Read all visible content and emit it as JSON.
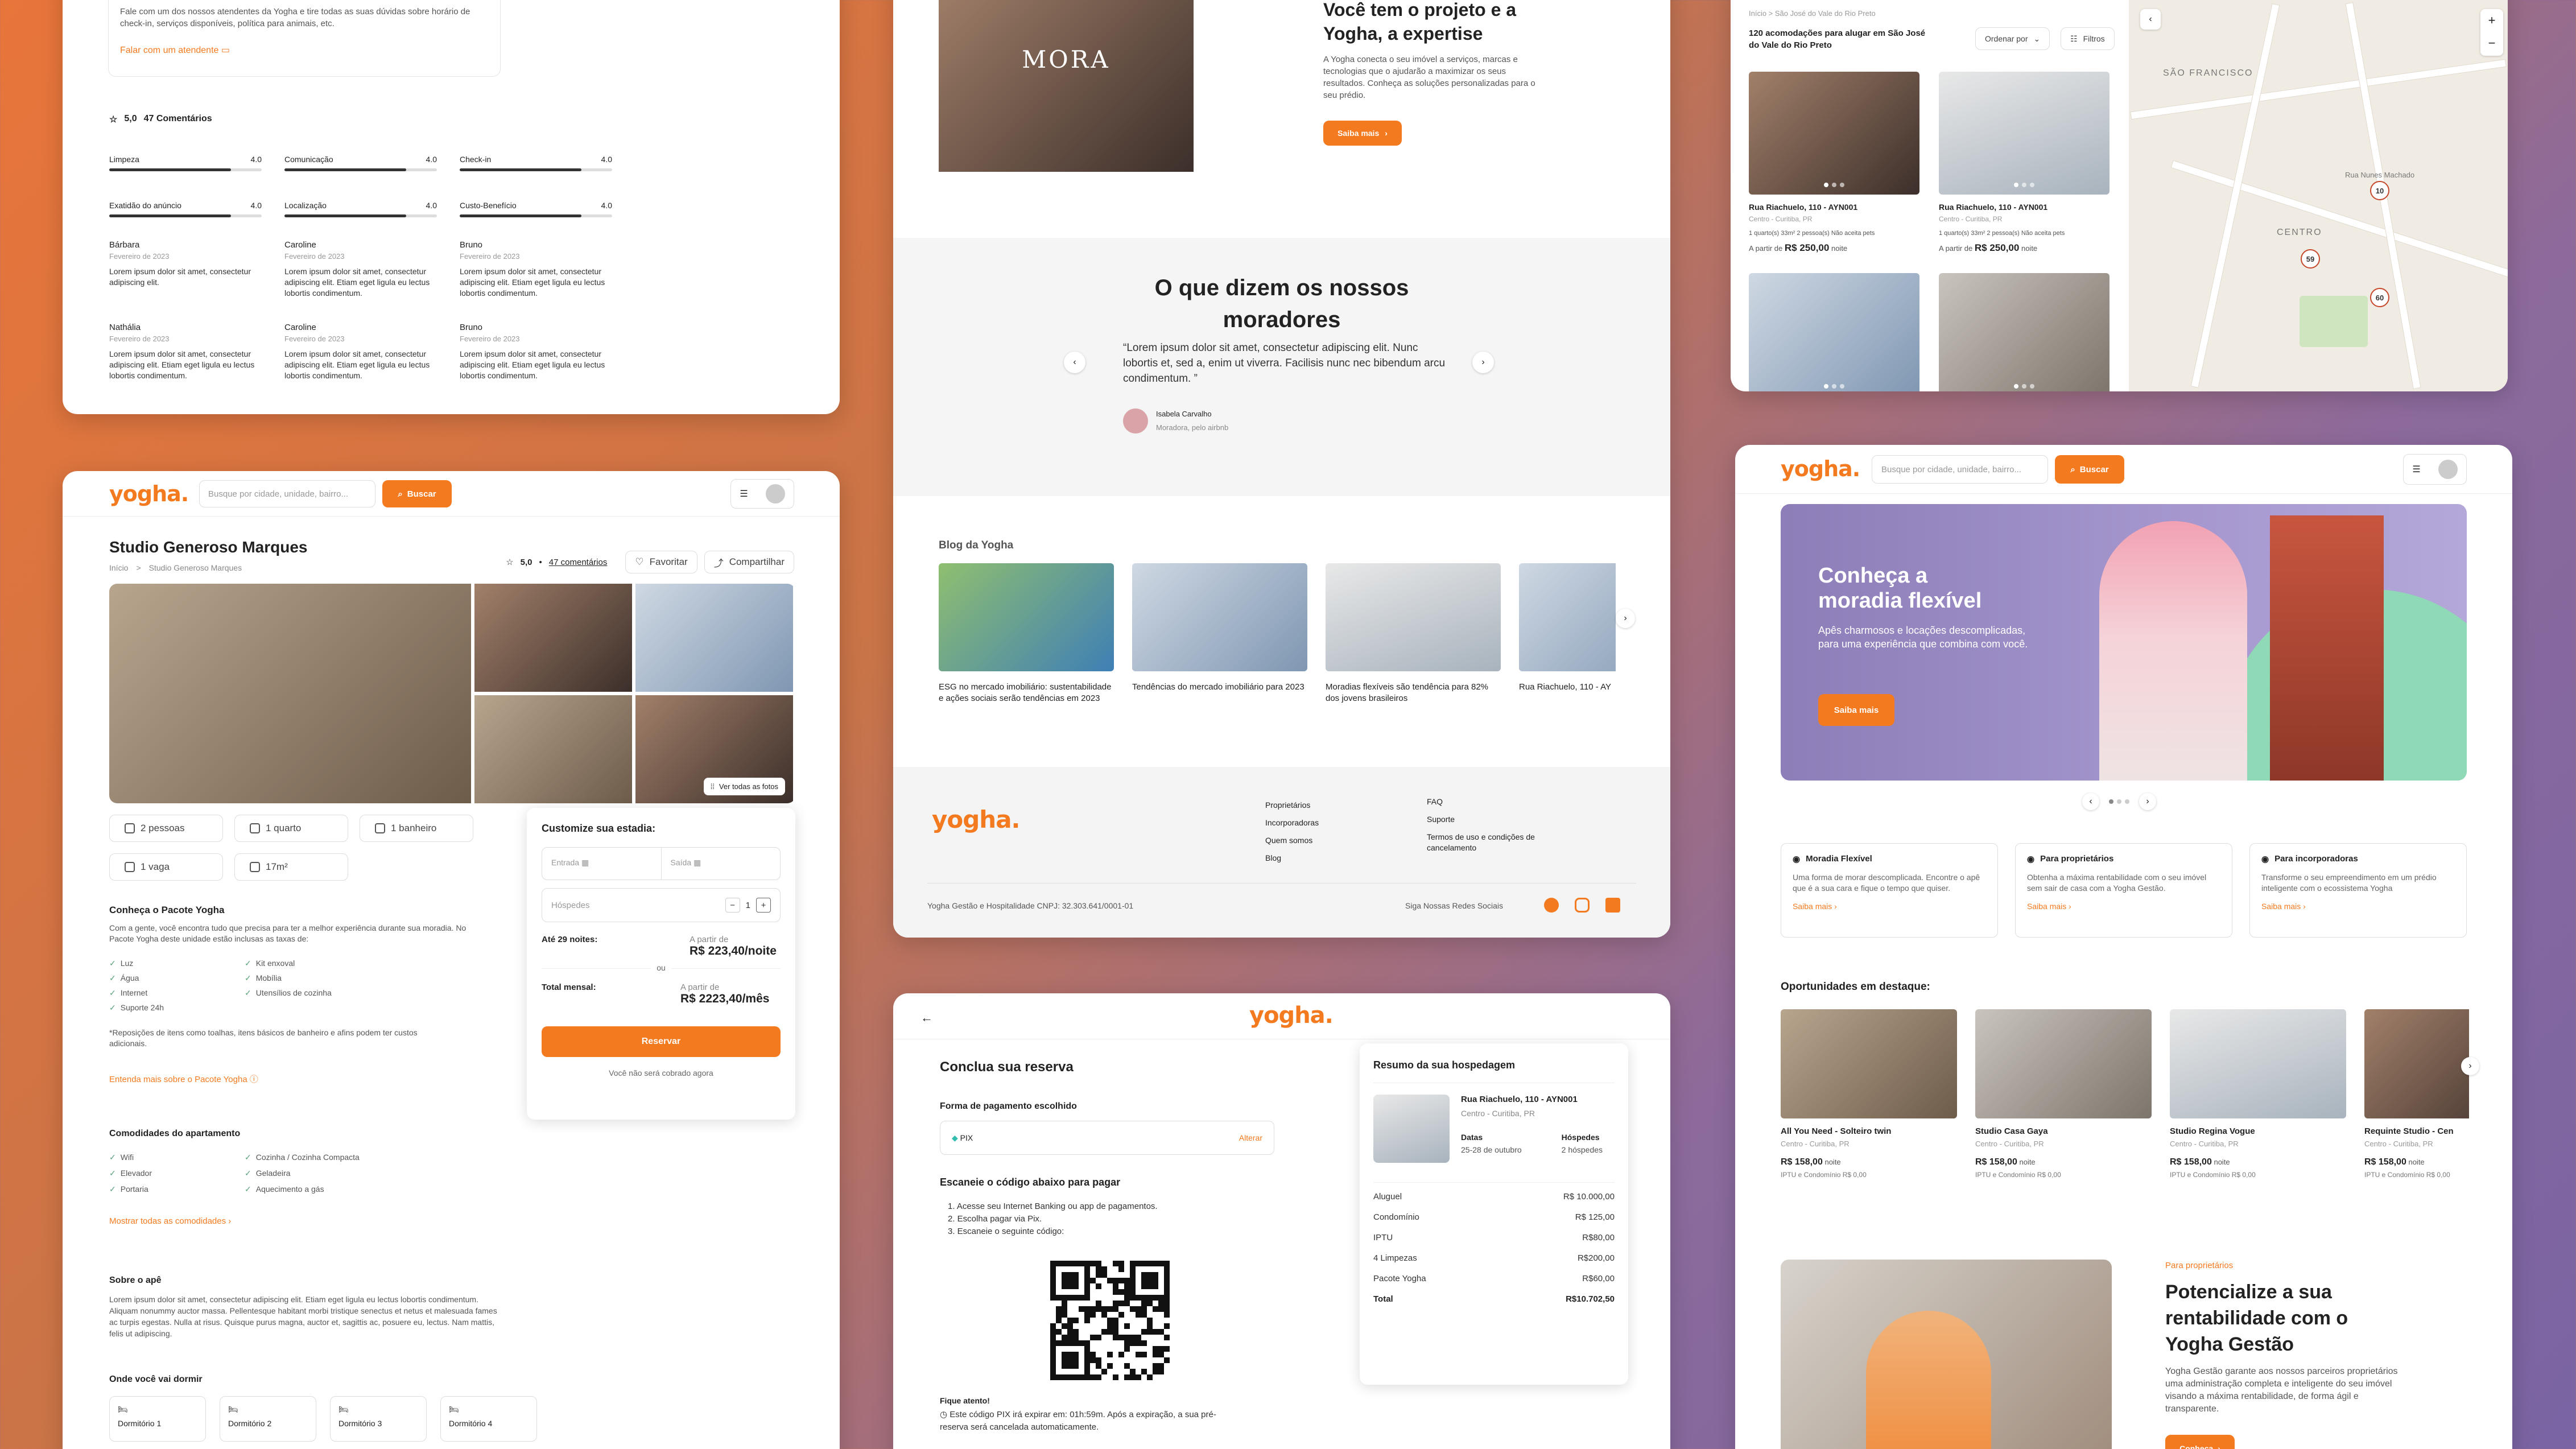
{
  "brand": {
    "logo": "yogha.",
    "accent": "#f47a20"
  },
  "reviews_card": {
    "intro": "Fale com um dos nossos atendentes da Yogha e tire todas as suas dúvidas sobre horário de check-in, serviços disponíveis, política para animais, etc.",
    "contact_link": "Falar com um atendente",
    "rating": "5,0",
    "comments": "47 Comentários",
    "criteria": [
      {
        "label": "Limpeza",
        "score": "4.0",
        "value": 0.8
      },
      {
        "label": "Comunicação",
        "score": "4.0",
        "value": 0.8
      },
      {
        "label": "Check-in",
        "score": "4.0",
        "value": 0.8
      },
      {
        "label": "Exatidão do anúncio",
        "score": "4.0",
        "value": 0.8
      },
      {
        "label": "Localização",
        "score": "4.0",
        "value": 0.8
      },
      {
        "label": "Custo-Benefício",
        "score": "4.0",
        "value": 0.8
      }
    ],
    "reviews": [
      {
        "name": "Bárbara",
        "date": "Fevereiro de 2023",
        "text": "Lorem ipsum dolor sit amet, consectetur adipiscing elit."
      },
      {
        "name": "Caroline",
        "date": "Fevereiro de 2023",
        "text": "Lorem ipsum dolor sit amet, consectetur adipiscing elit. Etiam eget ligula eu lectus lobortis condimentum."
      },
      {
        "name": "Bruno",
        "date": "Fevereiro de 2023",
        "text": "Lorem ipsum dolor sit amet, consectetur adipiscing elit. Etiam eget ligula eu lectus lobortis condimentum."
      },
      {
        "name": "Nathália",
        "date": "Fevereiro de 2023",
        "text": "Lorem ipsum dolor sit amet, consectetur adipiscing elit. Etiam eget ligula eu lectus lobortis condimentum."
      },
      {
        "name": "Caroline",
        "date": "Fevereiro de 2023",
        "text": "Lorem ipsum dolor sit amet, consectetur adipiscing elit. Etiam eget ligula eu lectus lobortis condimentum."
      },
      {
        "name": "Bruno",
        "date": "Fevereiro de 2023",
        "text": "Lorem ipsum dolor sit amet, consectetur adipiscing elit. Etiam eget ligula eu lectus lobortis condimentum."
      }
    ]
  },
  "listing": {
    "search_placeholder": "Busque por cidade, unidade, bairro...",
    "search_btn": "Buscar",
    "title": "Studio Generoso Marques",
    "breadcrumb": [
      "Início",
      ">",
      "Studio Generoso Marques"
    ],
    "rating": "5,0",
    "comments": "47 comentários",
    "fav": "Favoritar",
    "share": "Compartilhar",
    "see_photos": "Ver todas as fotos",
    "features": [
      "2 pessoas",
      "1 quarto",
      "1 banheiro",
      "1 vaga",
      "17m²"
    ],
    "pack_title": "Conheça o Pacote Yogha",
    "pack_text": "Com a gente, você encontra tudo que precisa para ter a melhor experiência durante sua moradia. No Pacote Yogha deste unidade estão inclusas as taxas de:",
    "pack_items_a": [
      "Luz",
      "Água",
      "Internet",
      "Suporte 24h"
    ],
    "pack_items_b": [
      "Kit enxoval",
      "Mobília",
      "Utensílios de cozinha"
    ],
    "pack_note": "*Reposições de itens como toalhas, itens básicos de banheiro e afins podem ter custos adicionais.",
    "pack_link": "Entenda mais sobre o Pacote Yogha",
    "amen_title": "Comodidades do apartamento",
    "amen_a": [
      "Wifi",
      "Elevador",
      "Portaria"
    ],
    "amen_b": [
      "Cozinha / Cozinha Compacta",
      "Geladeira",
      "Aquecimento a gás"
    ],
    "amen_link": "Mostrar todas as comodidades",
    "about_title": "Sobre o apê",
    "about_text": "Lorem ipsum dolor sit amet, consectetur adipiscing elit. Etiam eget ligula eu lectus lobortis condimentum. Aliquam nonummy auctor massa. Pellentesque habitant morbi tristique senectus et netus et malesuada fames ac turpis egestas. Nulla at risus. Quisque purus magna, auctor et, sagittis ac, posuere eu, lectus. Nam mattis, felis ut adipiscing.",
    "sleep_title": "Onde você vai dormir",
    "rooms": [
      "Dormitório 1",
      "Dormitório 2",
      "Dormitório 3",
      "Dormitório 4"
    ],
    "box": {
      "title": "Customize sua estadia:",
      "entrada": "Entrada",
      "saida": "Saída",
      "hospedes": "Hóspedes",
      "qty": "1",
      "nights_label": "Até 29 noites:",
      "from": "A partir de",
      "nightly": "R$ 223,40/noite",
      "or": "ou",
      "monthly_label": "Total mensal:",
      "monthly": "R$ 2223,40/mês",
      "reserve": "Reservar",
      "note": "Você não será cobrado agora"
    }
  },
  "home_mid": {
    "hero_title": "Você tem o projeto e a Yogha, a expertise",
    "hero_text": "A Yogha conecta o seu imóvel a serviços, marcas e tecnologias que o ajudarão a maximizar os seus resultados. Conheça as soluções personalizadas para o seu prédio.",
    "hero_btn": "Saiba mais",
    "building_sign": "MORA",
    "testi_title": "O que dizem os nossos moradores",
    "testi_quote": "“Lorem ipsum dolor sit amet, consectetur adipiscing elit. Nunc lobortis et, sed a, enim ut viverra. Facilisis nunc nec bibendum arcu condimentum. ”",
    "testi_name": "Isabela Carvalho",
    "testi_role": "Moradora, pelo airbnb",
    "blog_title": "Blog da Yogha",
    "posts": [
      "ESG no mercado imobiliário: sustentabilidade e ações sociais serão tendências em 2023",
      "Tendências do mercado imobiliário para 2023",
      "Moradias flexíveis são tendência para 82% dos jovens brasileiros",
      "Rua Riachuelo, 110 - AY"
    ],
    "footer_col1": [
      "Proprietários",
      "Incorporadoras",
      "Quem somos",
      "Blog"
    ],
    "footer_col2": [
      "FAQ",
      "Suporte",
      "Termos de uso e condições de cancelamento"
    ],
    "footer_legal": "Yogha Gestão e Hospitalidade CNPJ: 32.303.641/0001-01",
    "footer_social": "Siga Nossas Redes Sociais"
  },
  "checkout": {
    "title": "Conclua sua reserva",
    "pay_label": "Forma de pagamento escolhido",
    "pay_method": "PIX",
    "pay_change": "Alterar",
    "scan_title": "Escaneie o código abaixo para pagar",
    "steps": [
      "1. Acesse seu Internet Banking ou app de pagamentos.",
      "2. Escolha pagar via Pix.",
      "3. Escaneie o seguinte código:"
    ],
    "warn_title": "Fique atento!",
    "warn_text": "Este código PIX irá expirar em: 01h:59m. Após a expiração, a sua pré-reserva será cancelada automaticamente.",
    "summary_title": "Resumo da sua hospedagem",
    "unit": "Rua Riachuelo, 110 - AYN001",
    "unit_loc": "Centro - Curitiba, PR",
    "dates_label": "Datas",
    "dates": "25-28 de outubro",
    "guests_label": "Hóspedes",
    "guests": "2 hóspedes",
    "costs": [
      {
        "label": "Aluguel",
        "value": "R$ 10.000,00"
      },
      {
        "label": "Condomínio",
        "value": "R$ 125,00"
      },
      {
        "label": "IPTU",
        "value": "R$80,00"
      },
      {
        "label": "4 Limpezas",
        "value": "R$200,00"
      },
      {
        "label": "Pacote Yogha",
        "value": "R$60,00"
      }
    ],
    "total_label": "Total",
    "total": "R$10.702,50"
  },
  "search_map": {
    "breadcrumb": "Início  >  São José do Vale do Rio Preto",
    "count": "120 acomodações para alugar em São José do Vale do Rio Preto",
    "sort": "Ordenar por",
    "filters": "Filtros",
    "cards": [
      {
        "title": "Rua Riachuelo, 110 - AYN001",
        "loc": "Centro - Curitiba, PR",
        "specs": "1 quarto(s)  33m²  2 pessoa(s)  Não aceita pets",
        "from": "A partir de",
        "price": "R$ 250,00",
        "unit": "noite"
      },
      {
        "title": "Rua Riachuelo, 110 - AYN001",
        "loc": "Centro - Curitiba, PR",
        "specs": "1 quarto(s)  33m²  2 pessoa(s)  Não aceita pets",
        "from": "A partir de",
        "price": "R$ 250,00",
        "unit": "noite"
      }
    ],
    "map_labels": [
      "SÃO FRANCISCO",
      "CENTRO",
      "Rua Nunes Machado"
    ],
    "pins": [
      "10",
      "59",
      "60"
    ]
  },
  "home_right": {
    "search_placeholder": "Busque por cidade, unidade, bairro...",
    "search_btn": "Buscar",
    "hero_title": "Conheça a moradia flexível",
    "hero_text": "Apês charmosos e locações descomplicadas, para uma experiência que combina com você.",
    "hero_btn": "Saiba mais",
    "features": [
      {
        "title": "Moradia Flexível",
        "text": "Uma forma de morar descomplicada. Encontre o apê que é a sua cara e fique o tempo que quiser.",
        "link": "Saiba mais"
      },
      {
        "title": "Para proprietários",
        "text": "Obtenha a máxima rentabilidade com o seu imóvel sem sair de casa com a Yogha Gestão.",
        "link": "Saiba mais"
      },
      {
        "title": "Para incorporadoras",
        "text": "Transforme o seu empreendimento em um prédio inteligente com o ecossistema Yogha",
        "link": "Saiba mais"
      }
    ],
    "opps_title": "Oportunidades em destaque:",
    "opps": [
      {
        "title": "All You Need - Solteiro twin",
        "loc": "Centro - Curitiba, PR",
        "price": "R$ 158,00",
        "unit": "noite",
        "extra": "IPTU e Condomínio R$ 0,00"
      },
      {
        "title": "Studio Casa Gaya",
        "loc": "Centro - Curitiba, PR",
        "price": "R$ 158,00",
        "unit": "noite",
        "extra": "IPTU e Condomínio R$ 0,00"
      },
      {
        "title": "Studio Regina Vogue",
        "loc": "Centro - Curitiba, PR",
        "price": "R$ 158,00",
        "unit": "noite",
        "extra": "IPTU e Condomínio R$ 0,00"
      },
      {
        "title": "Requinte Studio - Cen",
        "loc": "Centro - Curitiba, PR",
        "price": "R$ 158,00",
        "unit": "noite",
        "extra": "IPTU e Condomínio R$ 0,00"
      }
    ],
    "owner_eyebrow": "Para proprietários",
    "owner_title": "Potencialize a sua rentabilidade com o Yogha Gestão",
    "owner_text": "Yogha Gestão garante aos nossos parceiros proprietários uma administração completa e inteligente do seu imóvel visando a máxima rentabilidade, de forma ágil e transparente.",
    "owner_btn": "Conheça"
  }
}
